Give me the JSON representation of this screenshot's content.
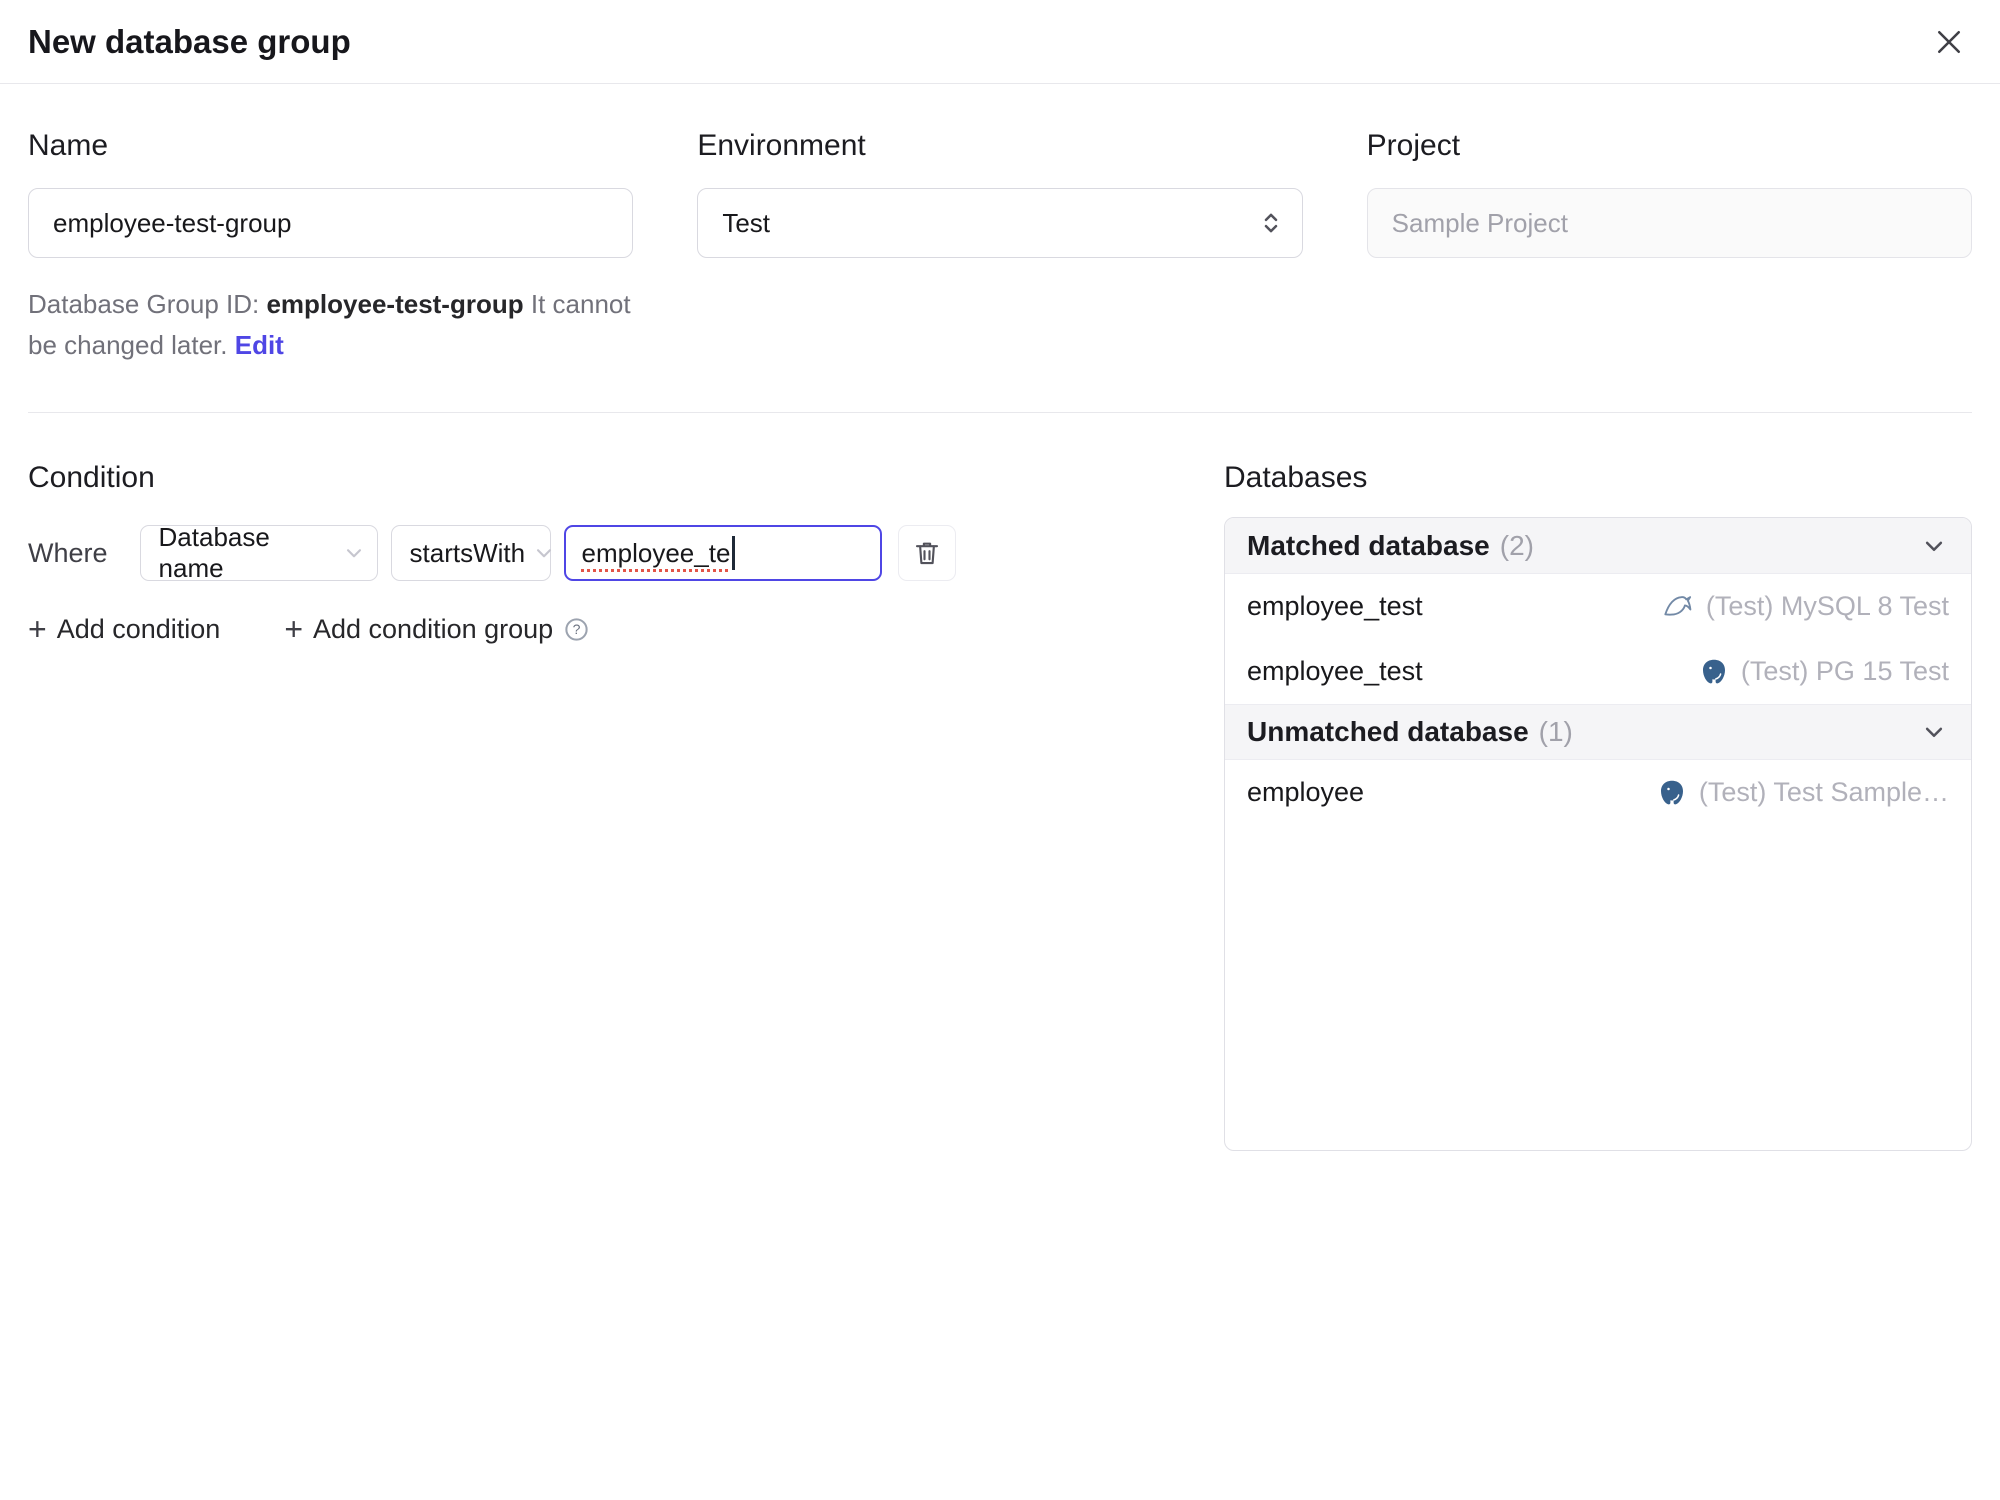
{
  "dialog": {
    "title": "New database group"
  },
  "form": {
    "name": {
      "label": "Name",
      "value": "employee-test-group"
    },
    "environment": {
      "label": "Environment",
      "value": "Test"
    },
    "project": {
      "label": "Project",
      "value": "Sample Project"
    },
    "id_help": {
      "prefix": "Database Group ID:",
      "id": "employee-test-group",
      "suffix": "It cannot be changed later.",
      "edit_label": "Edit"
    }
  },
  "condition": {
    "heading": "Condition",
    "where_label": "Where",
    "field_select": "Database name",
    "operator_select": "startsWith",
    "value_input": "employee_te",
    "add_condition_label": "Add condition",
    "add_condition_group_label": "Add condition group"
  },
  "databases": {
    "heading": "Databases",
    "matched": {
      "title": "Matched database",
      "count": "(2)",
      "rows": [
        {
          "name": "employee_test",
          "engine": "mysql",
          "env": "(Test) MySQL 8 Test"
        },
        {
          "name": "employee_test",
          "engine": "postgresql",
          "env": "(Test) PG 15 Test"
        }
      ]
    },
    "unmatched": {
      "title": "Unmatched database",
      "count": "(1)",
      "rows": [
        {
          "name": "employee",
          "engine": "postgresql",
          "env": "(Test) Test Sample…"
        }
      ]
    }
  },
  "colors": {
    "accent": "#4f46e5",
    "muted_text": "#a1a1aa",
    "border": "#e0e0e6",
    "section_bg": "#f5f5f7",
    "spellcheck_underline": "#e25549"
  }
}
